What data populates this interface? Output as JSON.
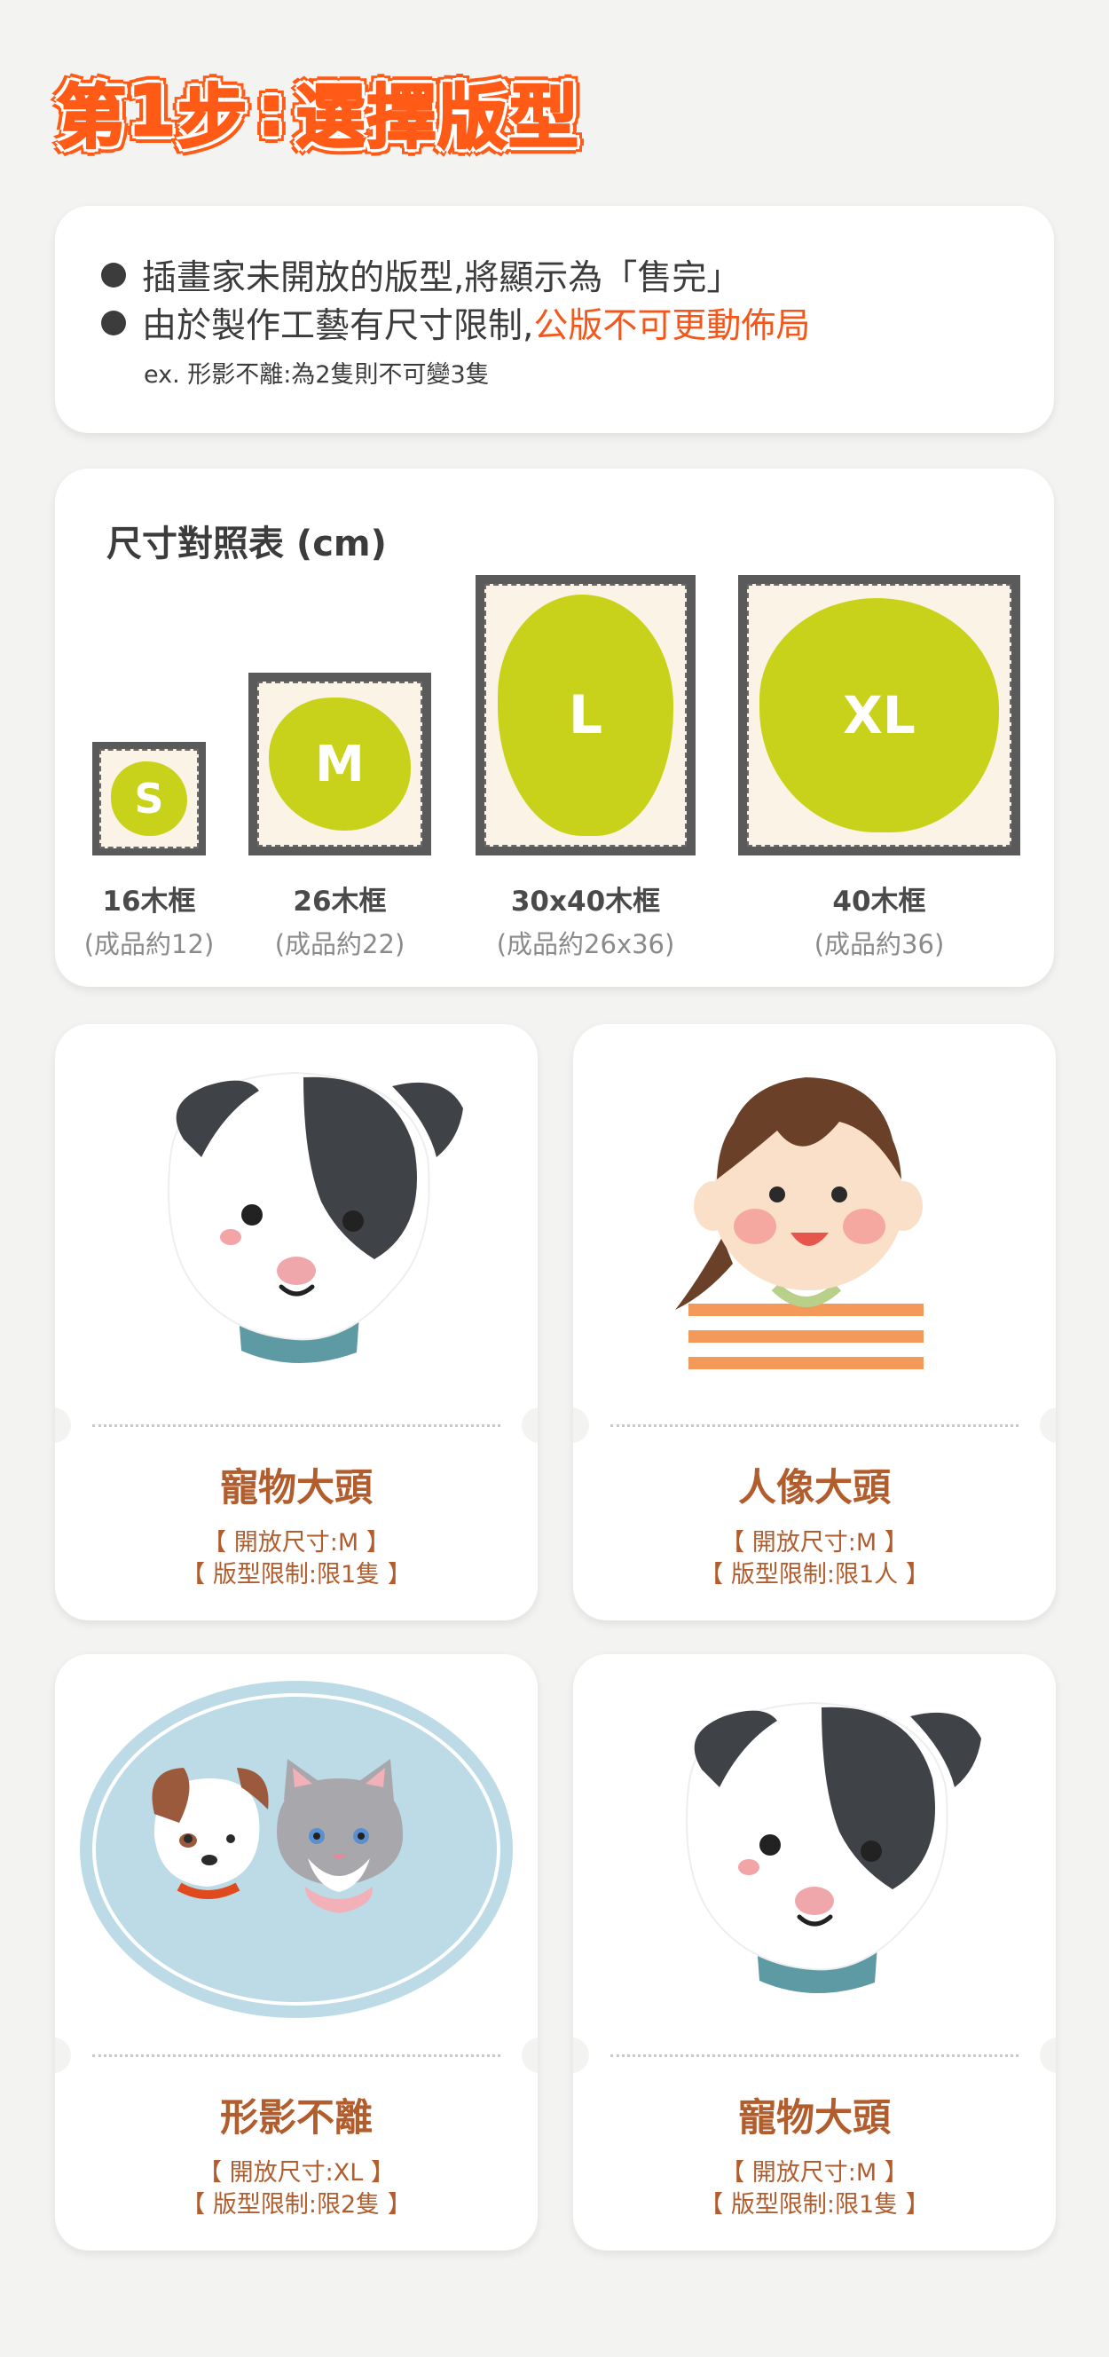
{
  "title": {
    "prefix": "第",
    "number": "1",
    "step": "步",
    "colon": ":",
    "text": "選擇版型"
  },
  "notes": {
    "line1": "插畫家未開放的版型,將顯示為「售完」",
    "line2_prefix": "由於製作工藝有尺寸限制,",
    "line2_highlight": "公版不可更動佈局",
    "example": "ex. 形影不離:為2隻則不可變3隻"
  },
  "size_chart": {
    "title": "尺寸對照表 (cm)",
    "sizes": [
      {
        "code": "S",
        "frame": "16木框",
        "product": "(成品約12)"
      },
      {
        "code": "M",
        "frame": "26木框",
        "product": "(成品約22)"
      },
      {
        "code": "L",
        "frame": "30x40木框",
        "product": "(成品約26x36)"
      },
      {
        "code": "XL",
        "frame": "40木框",
        "product": "(成品約36)"
      }
    ]
  },
  "products": [
    {
      "name": "寵物大頭",
      "size": "【 開放尺寸:M 】",
      "limit": "【 版型限制:限1隻 】",
      "art": "dog-portrait"
    },
    {
      "name": "人像大頭",
      "size": "【 開放尺寸:M 】",
      "limit": "【 版型限制:限1人 】",
      "art": "girl-portrait"
    },
    {
      "name": "形影不離",
      "size": "【 開放尺寸:XL 】",
      "limit": "【 版型限制:限2隻 】",
      "art": "dog-and-cat-oval"
    },
    {
      "name": "寵物大頭",
      "size": "【 開放尺寸:M 】",
      "limit": "【 版型限制:限1隻 】",
      "art": "dog-portrait"
    }
  ],
  "colors": {
    "accent": "#ff5a16",
    "highlight": "#f2581b",
    "product_text": "#b25d2d",
    "blob": "#c9d21a",
    "frame": "#5a5a5a"
  }
}
